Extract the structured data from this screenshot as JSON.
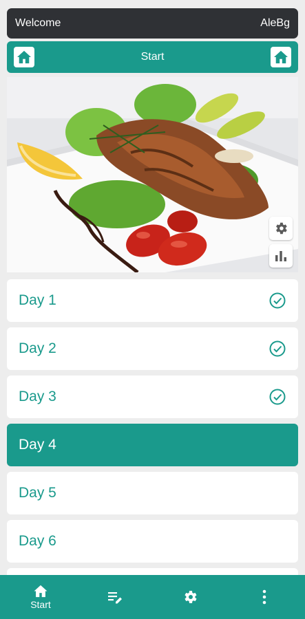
{
  "header": {
    "welcome": "Welcome",
    "user": "AleBg"
  },
  "subheader": {
    "title": "Start"
  },
  "days": [
    {
      "label": "Day 1",
      "completed": true,
      "active": false
    },
    {
      "label": "Day 2",
      "completed": true,
      "active": false
    },
    {
      "label": "Day 3",
      "completed": true,
      "active": false
    },
    {
      "label": "Day 4",
      "completed": false,
      "active": true
    },
    {
      "label": "Day 5",
      "completed": false,
      "active": false
    },
    {
      "label": "Day 6",
      "completed": false,
      "active": false
    }
  ],
  "bottom_nav": {
    "home_label": "Start",
    "icons": [
      "home-icon",
      "edit-list-icon",
      "gear-icon",
      "more-vertical-icon"
    ]
  },
  "colors": {
    "accent": "#1a9a8c",
    "header": "#2f3135",
    "background": "#ededed"
  }
}
